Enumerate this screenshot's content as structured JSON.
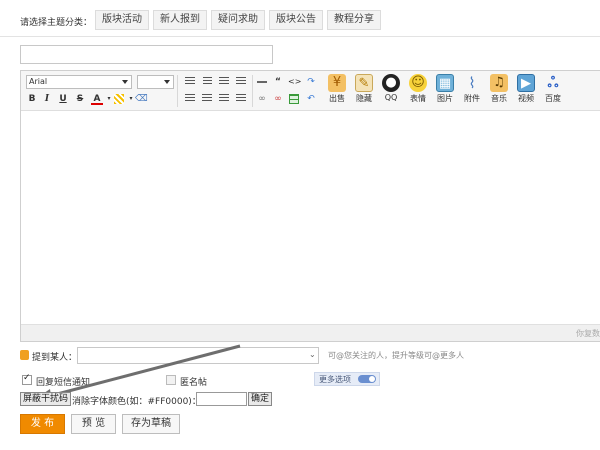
{
  "topic": {
    "label": "请选择主题分类：",
    "tabs": [
      "版块活动",
      "新人报到",
      "疑问求助",
      "版块公告",
      "教程分享"
    ]
  },
  "subject": {
    "value": ""
  },
  "toolbar": {
    "font": "Arial",
    "font_size": "",
    "format_buttons": [
      "B",
      "I",
      "U",
      "S",
      "A"
    ],
    "insert_tools": [
      {
        "name": "sale",
        "label": "出售"
      },
      {
        "name": "hide",
        "label": "隐藏"
      },
      {
        "name": "qq",
        "label": "QQ"
      },
      {
        "name": "emoji",
        "label": "表情"
      },
      {
        "name": "image",
        "label": "图片"
      },
      {
        "name": "attachment",
        "label": "附件"
      },
      {
        "name": "music",
        "label": "音乐"
      },
      {
        "name": "video",
        "label": "视频"
      },
      {
        "name": "baidu",
        "label": "百度"
      }
    ]
  },
  "editor": {
    "status": "你复数"
  },
  "mention": {
    "label": "提到某人：",
    "value": "",
    "hint": "可@您关注的人，提升等级可@更多人"
  },
  "options": {
    "reply_notify_label": "回复短信通知",
    "reply_notify_checked": true,
    "anonymous_label": "匿名帖",
    "anonymous_checked": false,
    "more_options_label": "更多选项"
  },
  "antispam": {
    "mask_button": "屏蔽干扰码",
    "color_label": "消除字体颜色(如：#FF0000)：",
    "color_value": "",
    "confirm_button": "确定"
  },
  "actions": {
    "publish": "发 布",
    "preview": "预 览",
    "save_draft": "存为草稿"
  },
  "colors": {
    "accent": "#f08a00",
    "toggle": "#6a8fd0"
  }
}
